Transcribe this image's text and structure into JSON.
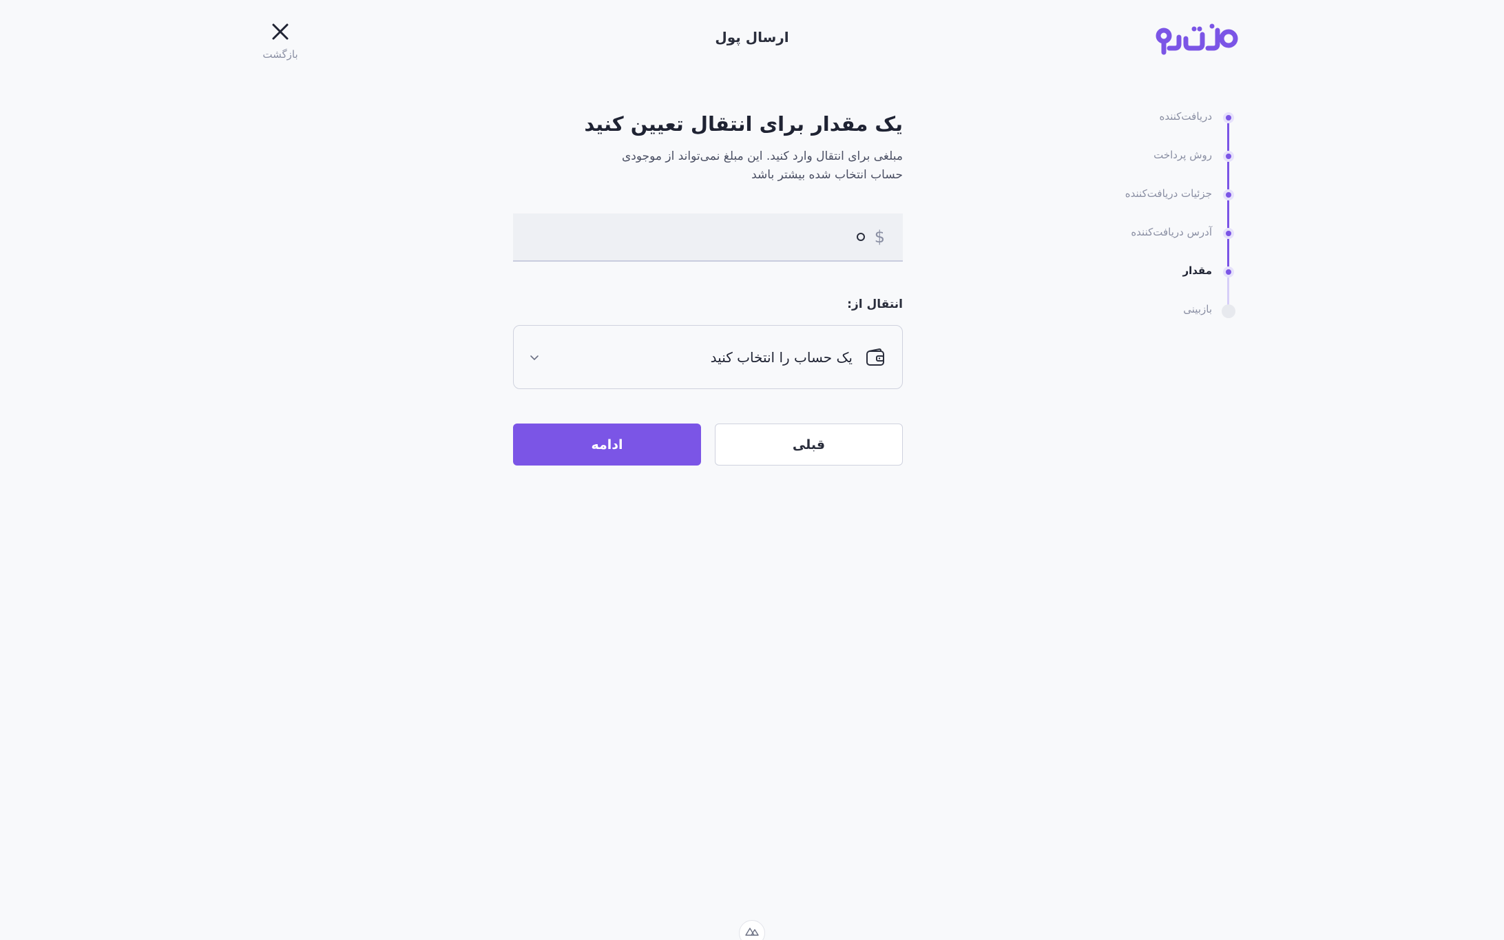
{
  "header": {
    "title": "ارسال پول",
    "close_label": "بازگشت"
  },
  "stepper": {
    "steps": [
      {
        "label": "دریافت‌کننده",
        "state": "done"
      },
      {
        "label": "روش پرداخت",
        "state": "done"
      },
      {
        "label": "جزئیات دریافت‌کننده",
        "state": "done"
      },
      {
        "label": "آدرس دریافت‌کننده",
        "state": "done"
      },
      {
        "label": "مقدار",
        "state": "active"
      },
      {
        "label": "بازبینی",
        "state": "pending"
      }
    ]
  },
  "main": {
    "title": "یک مقدار برای انتقال تعیین کنید",
    "description": "مبلغی برای انتقال وارد کنید. این مبلغ نمی‌تواند از موجودی حساب انتخاب شده بیشتر باشد",
    "amount": {
      "currency_symbol": "$",
      "value": "0"
    },
    "from_label": "انتقال از:",
    "account_select": {
      "placeholder": "یک حساب را انتخاب کنید",
      "icon": "wallet-icon"
    },
    "prev_button": "قبلی",
    "next_button": "ادامه"
  },
  "colors": {
    "accent": "#7b55e6",
    "background": "#f8f9fb",
    "text": "#1f2333",
    "muted": "#8a8fa3"
  }
}
